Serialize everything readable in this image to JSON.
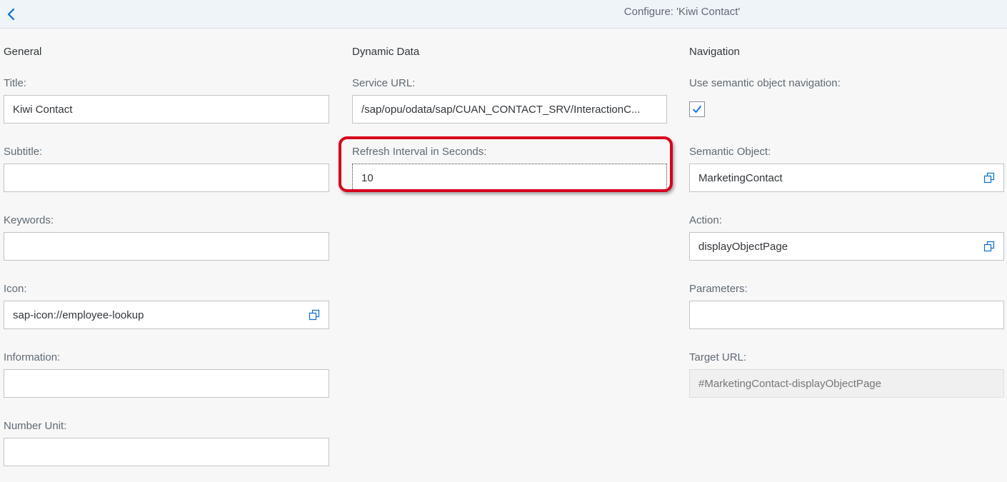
{
  "header": {
    "title": "Configure: 'Kiwi Contact'",
    "back_icon": "chevron-left-icon"
  },
  "general": {
    "section_title": "General",
    "title_label": "Title:",
    "title_value": "Kiwi Contact",
    "subtitle_label": "Subtitle:",
    "subtitle_value": "",
    "keywords_label": "Keywords:",
    "keywords_value": "",
    "icon_label": "Icon:",
    "icon_value": "sap-icon://employee-lookup",
    "information_label": "Information:",
    "information_value": "",
    "number_unit_label": "Number Unit:",
    "number_unit_value": ""
  },
  "dynamic_data": {
    "section_title": "Dynamic Data",
    "service_url_label": "Service URL:",
    "service_url_value": "/sap/opu/odata/sap/CUAN_CONTACT_SRV/InteractionC...",
    "refresh_label": "Refresh Interval in Seconds:",
    "refresh_value": "10"
  },
  "navigation": {
    "section_title": "Navigation",
    "semantic_nav_label": "Use semantic object navigation:",
    "semantic_nav_checked": true,
    "semantic_object_label": "Semantic Object:",
    "semantic_object_value": "MarketingContact",
    "action_label": "Action:",
    "action_value": "displayObjectPage",
    "parameters_label": "Parameters:",
    "parameters_value": "",
    "target_url_label": "Target URL:",
    "target_url_value": "#MarketingContact-displayObjectPage"
  },
  "colors": {
    "header_bg": "#eff4f9",
    "accent": "#0a6ed1",
    "highlight": "#d6001c"
  }
}
